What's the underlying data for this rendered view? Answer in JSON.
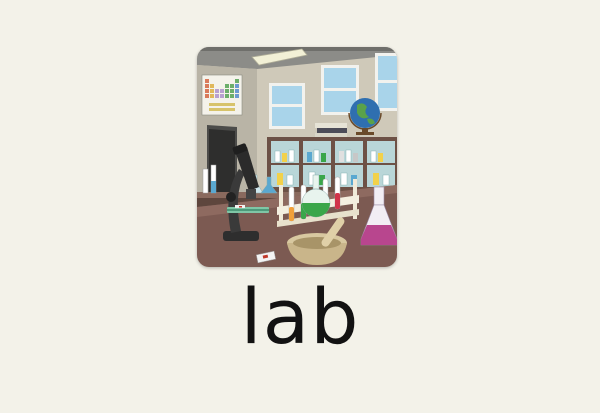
{
  "flashcard": {
    "word": "lab",
    "picture_subject": "science-laboratory-illustration"
  },
  "colors": {
    "background": "#f3f2e9",
    "text": "#121212",
    "bench": "#7c5a52",
    "wall": "#cfc9b9",
    "liquid_purple": "#b8468e",
    "liquid_green": "#3aa64a"
  }
}
